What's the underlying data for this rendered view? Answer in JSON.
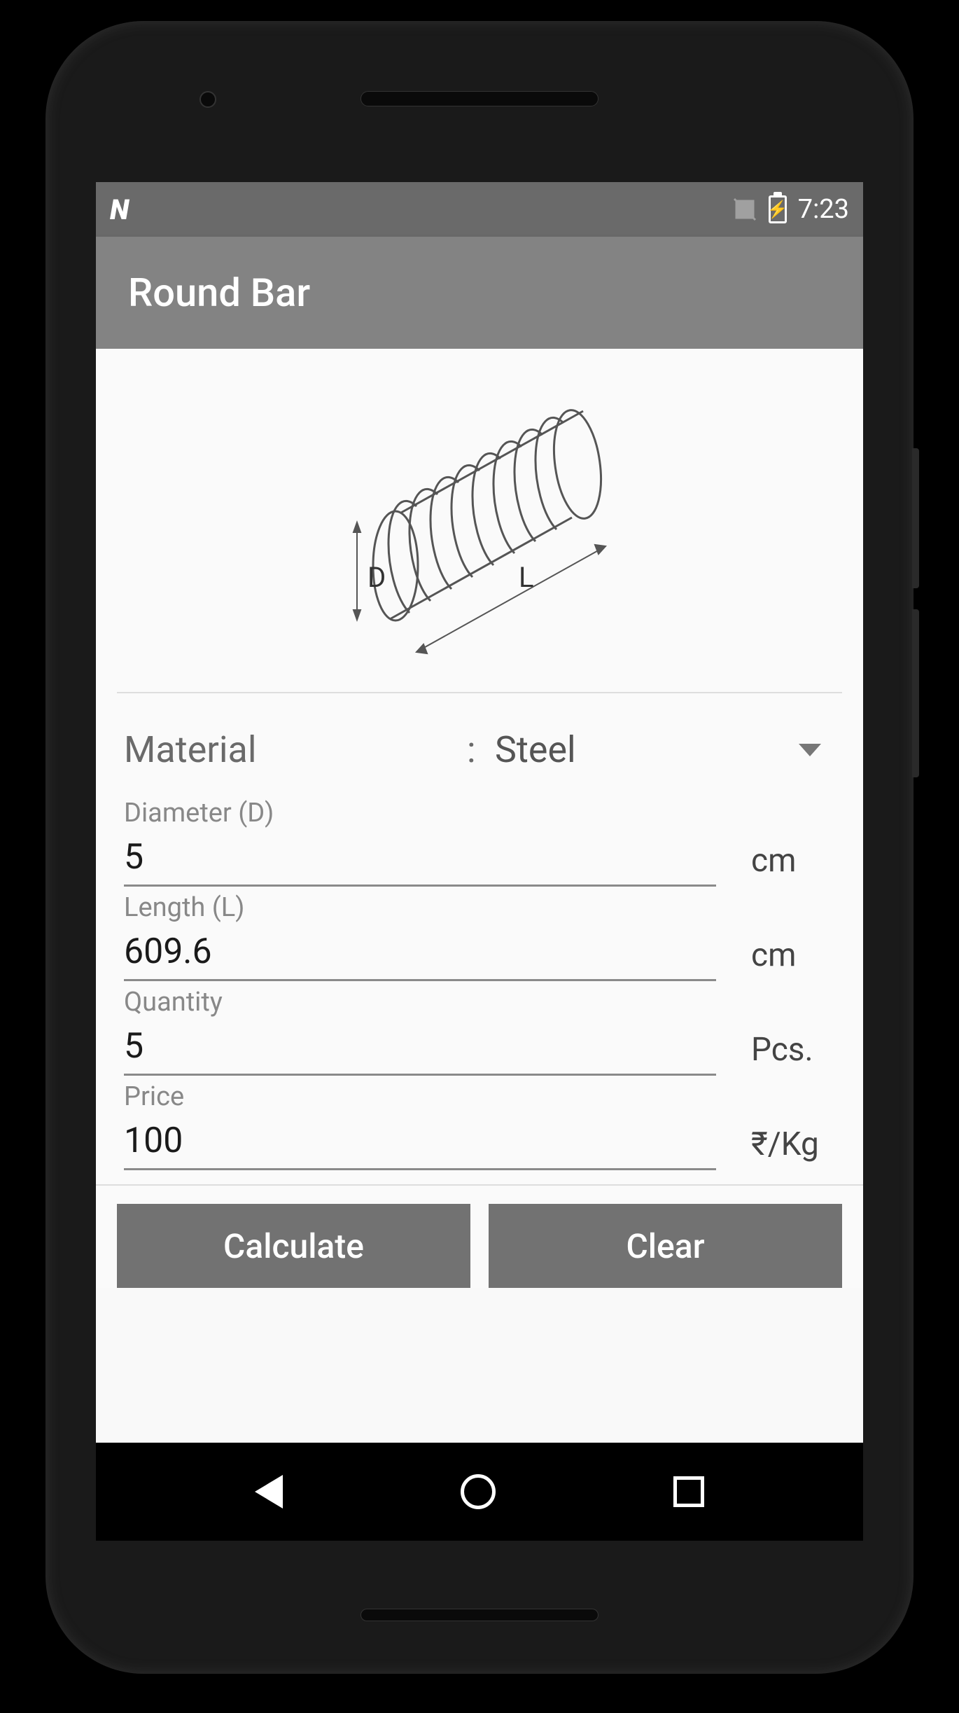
{
  "status_bar": {
    "time": "7:23"
  },
  "app_bar": {
    "title": "Round Bar"
  },
  "diagram": {
    "label_d": "D",
    "label_l": "L"
  },
  "form": {
    "material": {
      "label": "Material",
      "colon": ":",
      "value": "Steel"
    },
    "diameter": {
      "label": "Diameter (D)",
      "value": "5",
      "unit": "cm"
    },
    "length": {
      "label": "Length (L)",
      "value": "609.6",
      "unit": "cm"
    },
    "quantity": {
      "label": "Quantity",
      "value": "5",
      "unit": "Pcs."
    },
    "price": {
      "label": "Price",
      "value": "100",
      "unit": "₹/Kg"
    }
  },
  "buttons": {
    "calculate": "Calculate",
    "clear": "Clear"
  }
}
